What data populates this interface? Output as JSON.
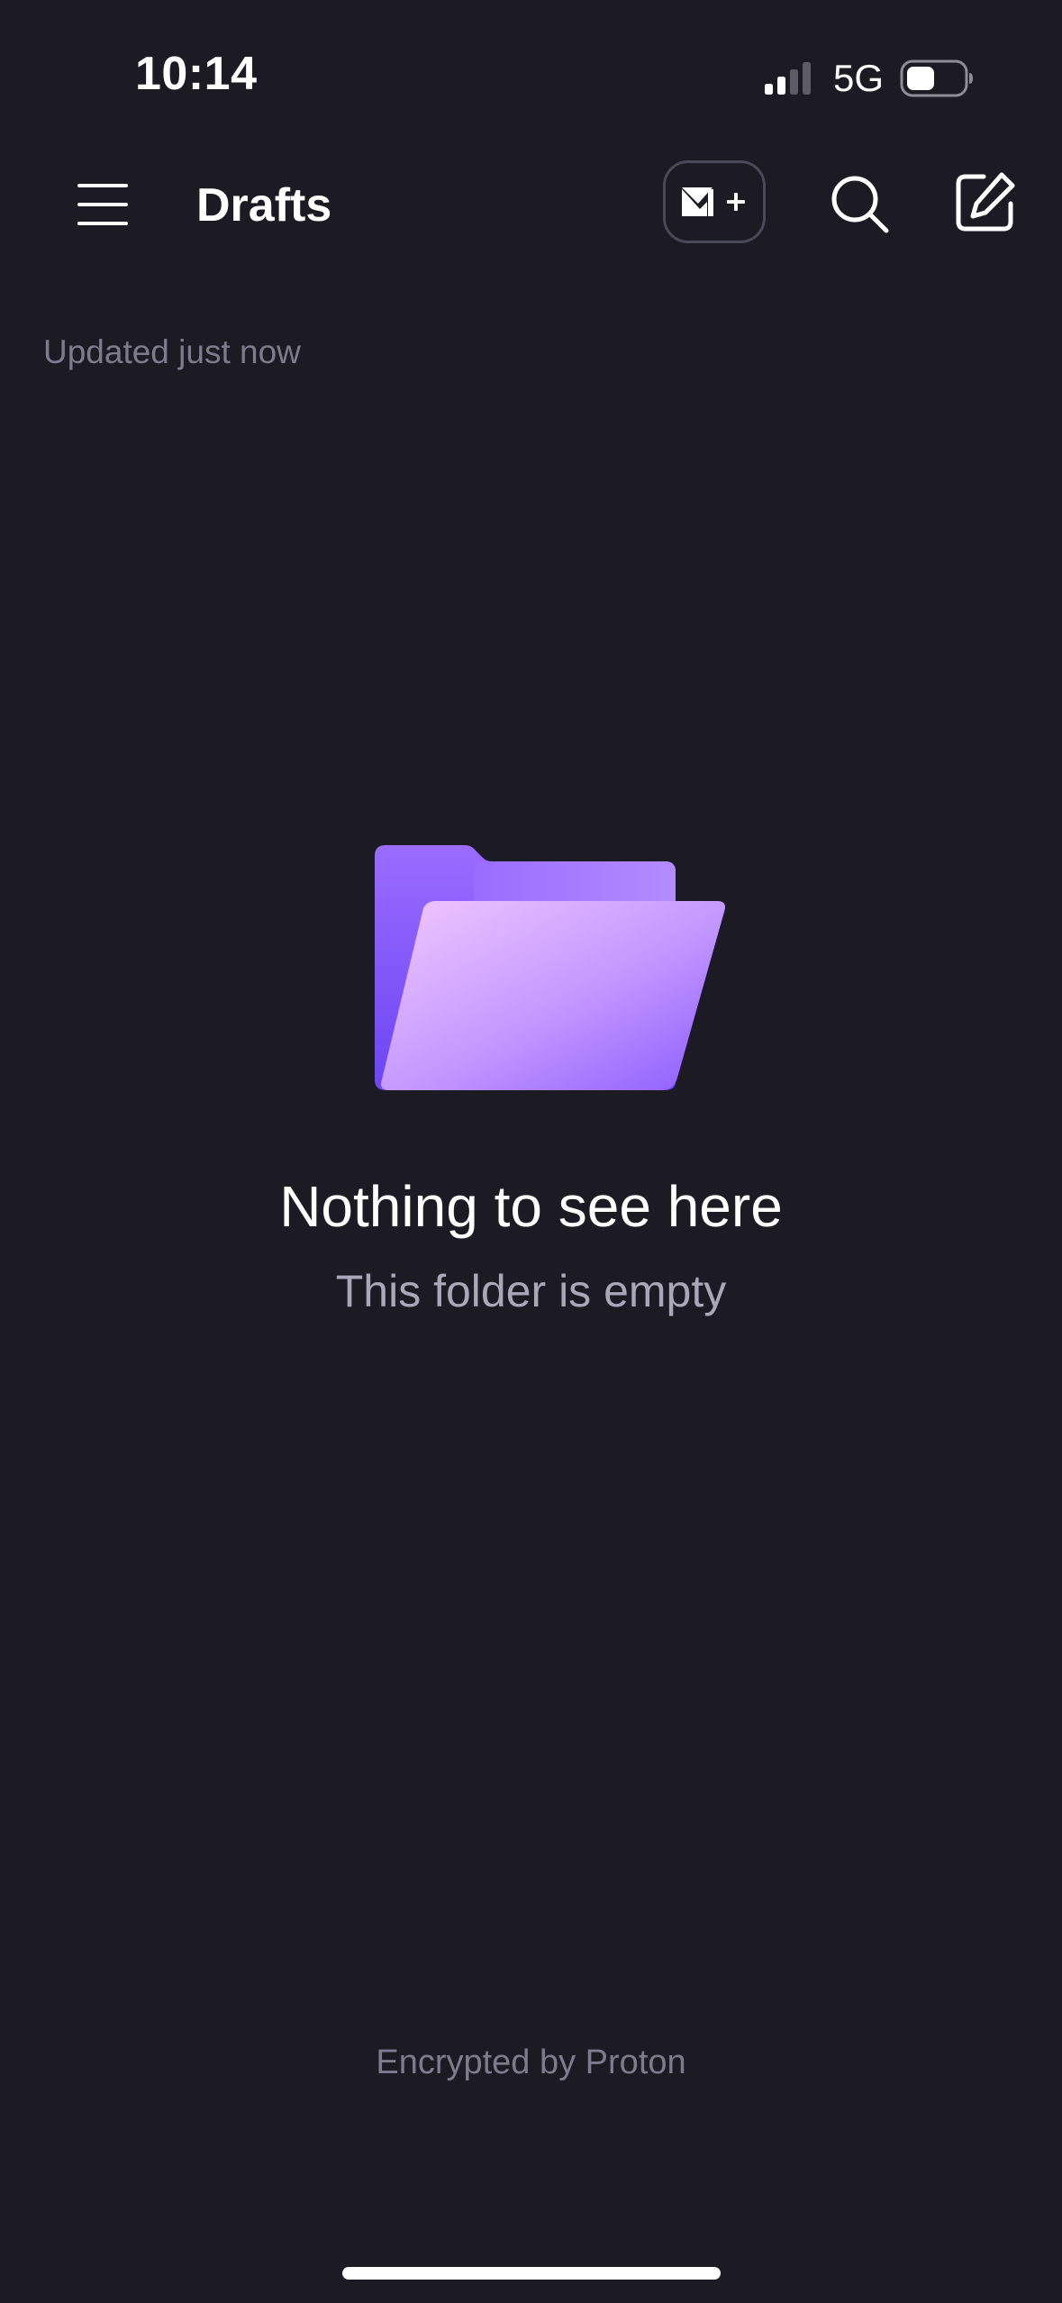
{
  "status_bar": {
    "time": "10:14",
    "network": "5G",
    "signal_bars_active": 2,
    "signal_bars_total": 4,
    "battery_level": 0.4
  },
  "header": {
    "title": "Drafts",
    "menu_icon": "hamburger-menu-icon",
    "upgrade_icon": "mail-plus-icon",
    "search_icon": "search-icon",
    "compose_icon": "compose-icon"
  },
  "updated_status": "Updated just now",
  "empty_state": {
    "icon": "open-folder-icon",
    "title": "Nothing to see here",
    "subtitle": "This folder is empty"
  },
  "footer": {
    "text": "Encrypted by Proton"
  },
  "colors": {
    "background": "#1c1b23",
    "accent": "#6d4aff",
    "muted_text": "#7d7b8c",
    "secondary_text": "#a9a7b8"
  }
}
